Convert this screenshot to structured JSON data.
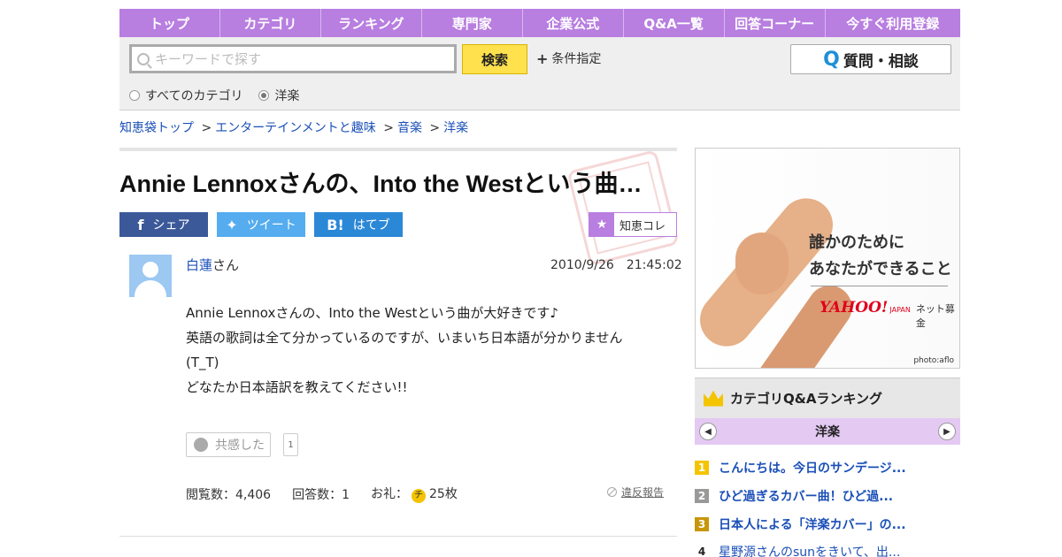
{
  "nav": [
    "トップ",
    "カテゴリ",
    "ランキング",
    "専門家",
    "企業公式",
    "Q&A一覧",
    "回答コーナー",
    "今すぐ利用登録"
  ],
  "search": {
    "placeholder": "キーワードで探す",
    "button": "検索",
    "condition": "条件指定",
    "ask_button": "質問・相談",
    "ask_q": "Q",
    "radios": [
      "すべてのカテゴリ",
      "洋楽"
    ],
    "selected": "洋楽"
  },
  "breadcrumb": [
    "知恵袋トップ",
    "エンターテインメントと趣味",
    "音楽",
    "洋楽"
  ],
  "question": {
    "title": "Annie Lennoxさんの、Into the Westという曲…",
    "share": {
      "facebook": "シェア",
      "twitter": "ツイート",
      "hatena": "はてブ",
      "chiekore": "知恵コレ"
    },
    "user": "白蓮",
    "user_suffix": "さん",
    "datetime": "2010/9/26　21:45:02",
    "body": [
      "Annie Lennoxさんの、Into the Westという曲が大好きです♪",
      "英語の歌詞は全て分かっているのですが、いまいち日本語が分かりません",
      "(T_T)",
      "どなたか日本語訳を教えてください!!"
    ],
    "empathy_label": "共感した",
    "empathy_count": "1",
    "views": "閲覧数：4,406",
    "answers": "回答数：1",
    "reward_label": "お礼：",
    "reward_coin": "チ",
    "reward": "25枚",
    "report": "違反報告"
  },
  "ad": {
    "line1": "誰かのために",
    "line2": "あなたができること",
    "logo": "YAHOO!",
    "logo_sub": "JAPAN",
    "service": "ネット募金",
    "credit": "photo:aflo"
  },
  "ranking": {
    "title": "カテゴリQ&Aランキング",
    "category": "洋楽",
    "items": [
      {
        "n": "1",
        "color": "#f4c400",
        "text": "こんにちは。今日のサンデージ..."
      },
      {
        "n": "2",
        "color": "#999999",
        "text": "ひど過ぎるカバー曲！ひど過..."
      },
      {
        "n": "3",
        "color": "#c8960a",
        "text": "日本人による「洋楽カバー」の..."
      },
      {
        "n": "4",
        "color": "#ffffff",
        "text": "星野源さんのsunをきいて、出..."
      }
    ]
  }
}
